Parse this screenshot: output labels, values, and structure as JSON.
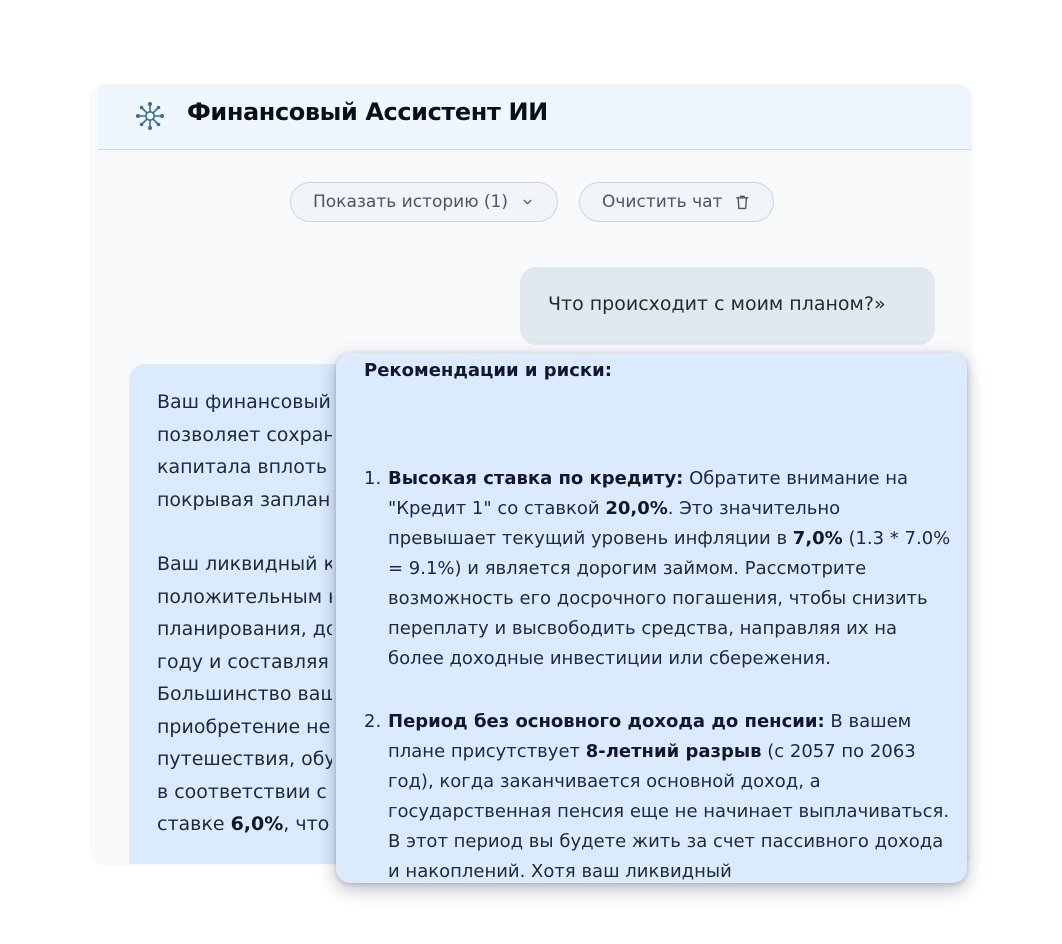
{
  "header": {
    "title": "Финансовый Ассистент ИИ",
    "logo_icon": "network-nodes-icon"
  },
  "toolbar": {
    "history_label": "Показать историю (1)",
    "history_icon": "chevron-down-icon",
    "clear_label": "Очистить чат",
    "clear_icon": "trash-icon"
  },
  "user_message": {
    "text": "Что происходит с моим планом?»"
  },
  "assistant_message": {
    "paragraph_1_lines": [
      "Ваш финансовый п",
      "позволяет сохрани",
      "капитала вплоть д",
      "покрывая заплани"
    ],
    "paragraph_2_lines": [
      "Ваш ликвидный ка",
      "положительным н",
      "планирования, до",
      "году и составляя",
      "Большинство ваш",
      "приобретение не",
      "путешествия, обу",
      "в соответствии с"
    ],
    "last_line_prefix": "ставке ",
    "last_line_bold": "6,0%",
    "last_line_suffix": ", что"
  },
  "popup": {
    "heading": "Рекомендации и риски:",
    "items": [
      {
        "number": "1.",
        "title": "Высокая ставка по кредиту:",
        "part_1": " Обратите внимание на \"Кредит 1\" со ставкой ",
        "bold_1": "20,0%",
        "part_2": ". Это значительно превышает текущий уровень инфляции в ",
        "bold_2": "7,0%",
        "part_3": " (1.3 * 7.0% = 9.1%) и является дорогим займом. Рассмотрите возможность его досрочного погашения, чтобы снизить переплату и высвободить средства, направляя их на более доходные инвестиции или сбережения."
      },
      {
        "number": "2.",
        "title": "Период без основного дохода до пенсии:",
        "part_1": " В вашем плане присутствует ",
        "bold_1": "8-летний разрыв",
        "part_2": " (с 2057 по 2063 год), когда заканчивается основной доход, а государственная пенсия еще не начинает выплачиваться. В этот период вы будете жить за счет пассивного дохода и накоплений. Хотя ваш ликвидный",
        "bold_2": "",
        "part_3": ""
      }
    ]
  },
  "colors": {
    "header_bg": "#eff6fd",
    "window_bg": "#f8fafc",
    "user_bubble": "#e2e8f0",
    "assistant_bubble": "#dbeafe",
    "logo": "#3b6e8f"
  }
}
